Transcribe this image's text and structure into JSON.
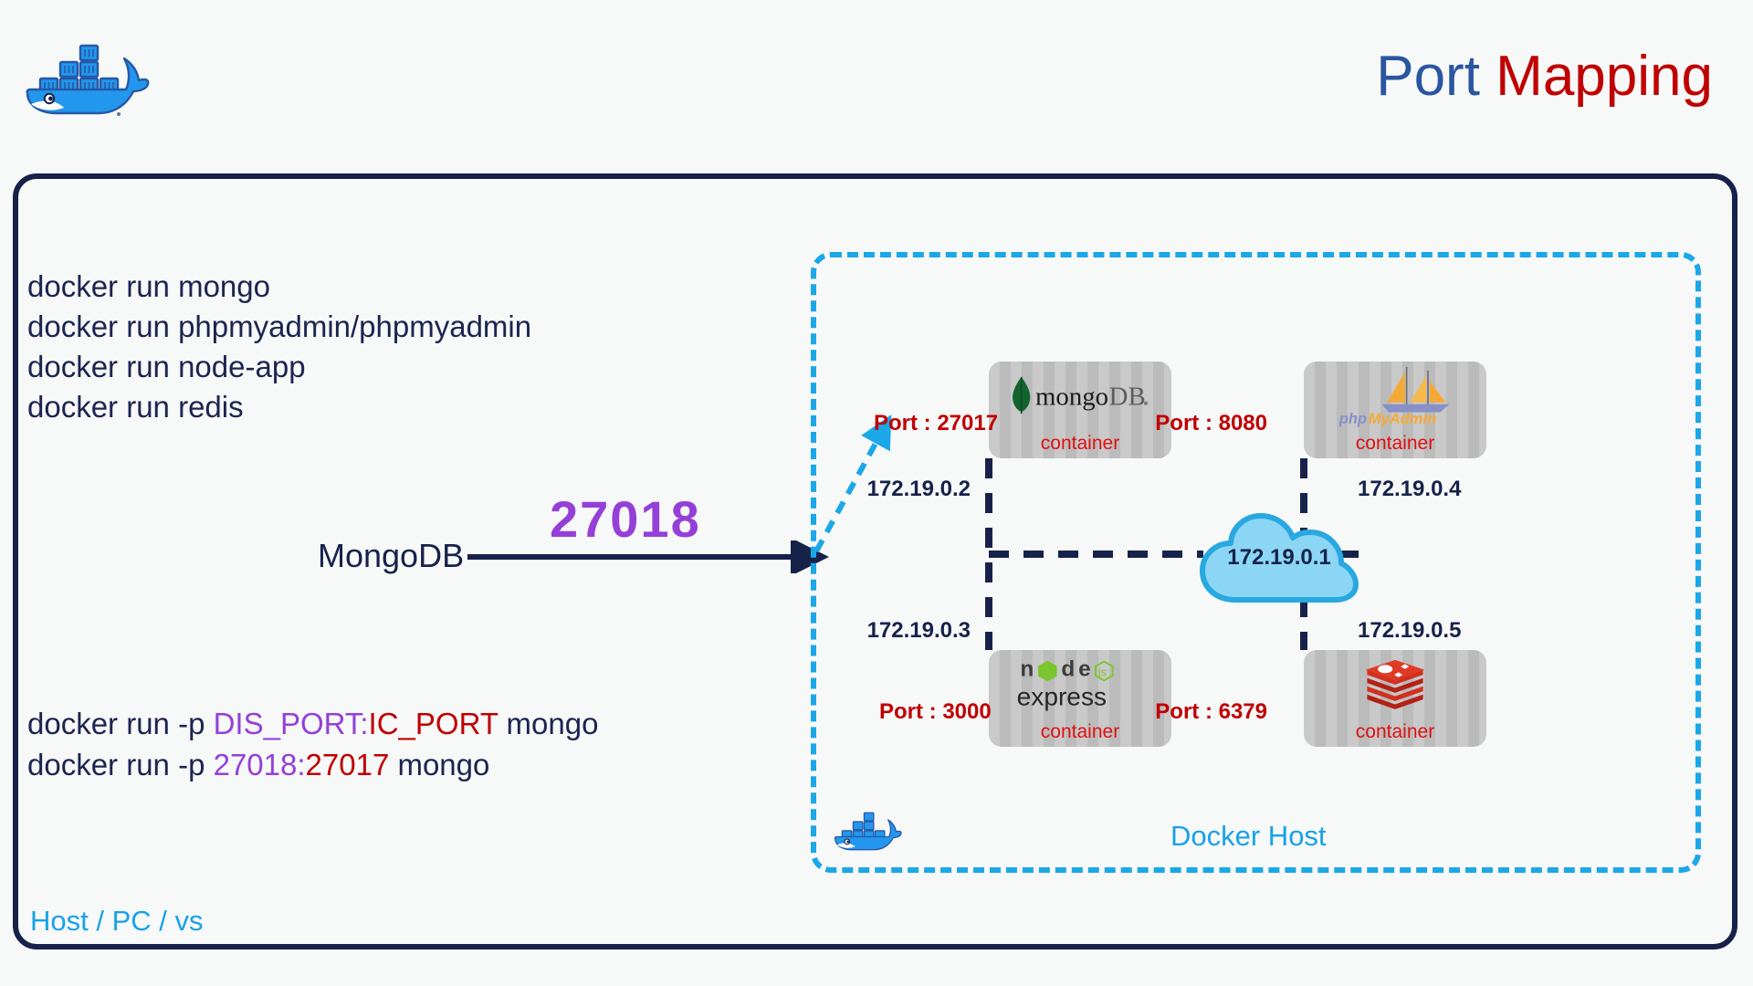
{
  "header": {
    "title_part1": "Port",
    "title_part2": "Mapping",
    "title_color_1": "#2a55a0",
    "title_color_2": "#c00000",
    "logo": "docker-whale-logo"
  },
  "left_panel": {
    "commands_top": [
      "docker run mongo",
      "docker run phpmyadmin/phpmyadmin",
      "docker run node-app",
      "docker run redis"
    ],
    "mapping": {
      "source_label": "MongoDB",
      "published_port": "27018",
      "published_port_color": "#9440d8"
    },
    "commands_bottom": {
      "line1": {
        "prefix": "docker run  -p ",
        "host_port": "DIS_PORT",
        "separator": ":",
        "container_port": "IC_PORT",
        "suffix": " mongo"
      },
      "line2": {
        "prefix": "docker run  -p ",
        "host_port": "27018",
        "separator": ":",
        "container_port": "27017",
        "suffix": " mongo"
      }
    },
    "host_label": "Host / PC / vs",
    "host_label_color": "#17a2e8"
  },
  "docker_host": {
    "label": "Docker Host",
    "label_color": "#17a2e8",
    "border_color": "#1ba7e8",
    "logo": "docker-whale-logo",
    "network_ip": "172.19.0.1",
    "containers": [
      {
        "id": "mongo",
        "logo": "mongodb-logo",
        "logo_text": "mongoDB",
        "caption": "container",
        "port_label": "Port : 27017",
        "ip": "172.19.0.2"
      },
      {
        "id": "phpmyadmin",
        "logo": "phpmyadmin-logo",
        "logo_text": "phpMyAdmin",
        "caption": "container",
        "port_label": "Port : 8080",
        "ip": "172.19.0.4"
      },
      {
        "id": "node",
        "logo": "node-express-logo",
        "logo_text": "node express",
        "caption": "container",
        "port_label": "Port : 3000",
        "ip": "172.19.0.3"
      },
      {
        "id": "redis",
        "logo": "redis-logo",
        "logo_text": "redis",
        "caption": "container",
        "port_label": "Port : 6379",
        "ip": "172.19.0.5"
      }
    ]
  }
}
